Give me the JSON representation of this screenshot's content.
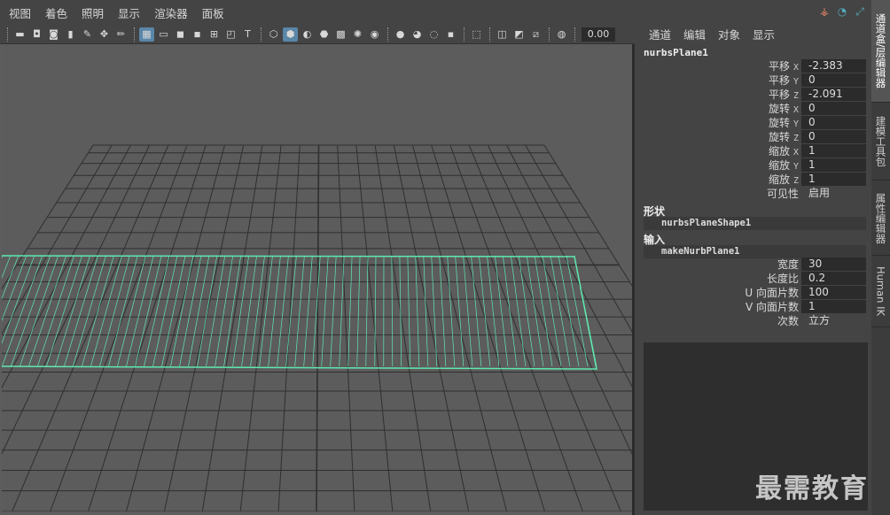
{
  "menubar": [
    "视图",
    "着色",
    "照明",
    "显示",
    "渲染器",
    "面板"
  ],
  "toolbar": {
    "groups": [
      [
        {
          "icon": "camera-icon",
          "glyph": "▬"
        },
        {
          "icon": "camera-attr-icon",
          "glyph": "◘"
        },
        {
          "icon": "camera-bookmark-icon",
          "glyph": "◙"
        },
        {
          "icon": "bookmark-icon",
          "glyph": "▮"
        },
        {
          "icon": "image-plane-icon",
          "glyph": "✎"
        },
        {
          "icon": "2d-pan-zoom-icon",
          "glyph": "✥"
        },
        {
          "icon": "grease-pencil-icon",
          "glyph": "✏"
        }
      ],
      [
        {
          "icon": "grid-icon",
          "glyph": "▦",
          "active": true
        },
        {
          "icon": "film-gate-icon",
          "glyph": "▭"
        },
        {
          "icon": "resolution-gate-icon",
          "glyph": "◼"
        },
        {
          "icon": "gate-mask-icon",
          "glyph": "◾"
        },
        {
          "icon": "field-chart-icon",
          "glyph": "⊞"
        },
        {
          "icon": "safe-action-icon",
          "glyph": "◰"
        },
        {
          "icon": "safe-title-icon",
          "glyph": "T"
        }
      ],
      [
        {
          "icon": "wireframe-icon",
          "glyph": "⬡"
        },
        {
          "icon": "smooth-shade-icon",
          "glyph": "⬢",
          "active": true
        },
        {
          "icon": "default-material-icon",
          "glyph": "◐"
        },
        {
          "icon": "wireframe-on-shaded-icon",
          "glyph": "⬣"
        },
        {
          "icon": "textured-icon",
          "glyph": "▩"
        },
        {
          "icon": "lights-icon",
          "glyph": "✺"
        },
        {
          "icon": "shadows-icon",
          "glyph": "◉"
        }
      ],
      [
        {
          "icon": "screen-space-ao-icon",
          "glyph": "●"
        },
        {
          "icon": "motion-blur-icon",
          "glyph": "◕"
        },
        {
          "icon": "anti-aliasing-icon",
          "glyph": "◌"
        },
        {
          "icon": "depth-of-field-icon",
          "glyph": "▪"
        }
      ],
      [
        {
          "icon": "isolate-select-icon",
          "glyph": "⬚"
        }
      ],
      [
        {
          "icon": "xray-icon",
          "glyph": "◫"
        },
        {
          "icon": "xray-joints-icon",
          "glyph": "◩"
        },
        {
          "icon": "xray-components-icon",
          "glyph": "⧄"
        }
      ],
      [
        {
          "icon": "exposure-icon",
          "glyph": "◍"
        }
      ]
    ],
    "time_value": "0.00"
  },
  "channel_box": {
    "menu": [
      "通道",
      "编辑",
      "对象",
      "显示"
    ],
    "object_name": "nurbsPlane1",
    "attributes": [
      {
        "label": "平移",
        "axis": "X",
        "value": "-2.383"
      },
      {
        "label": "平移",
        "axis": "Y",
        "value": "0"
      },
      {
        "label": "平移",
        "axis": "Z",
        "value": "-2.091"
      },
      {
        "label": "旋转",
        "axis": "X",
        "value": "0"
      },
      {
        "label": "旋转",
        "axis": "Y",
        "value": "0"
      },
      {
        "label": "旋转",
        "axis": "Z",
        "value": "0"
      },
      {
        "label": "缩放",
        "axis": "X",
        "value": "1"
      },
      {
        "label": "缩放",
        "axis": "Y",
        "value": "1"
      },
      {
        "label": "缩放",
        "axis": "Z",
        "value": "1"
      },
      {
        "label": "可见性",
        "axis": "",
        "value": "启用"
      }
    ],
    "shape_section": {
      "title": "形状",
      "node": "nurbsPlaneShape1"
    },
    "input_section": {
      "title": "输入",
      "node": "makeNurbPlane1",
      "attributes": [
        {
          "label": "宽度",
          "value": "30"
        },
        {
          "label": "长度比",
          "value": "0.2"
        },
        {
          "label": "U 向面片数",
          "value": "100"
        },
        {
          "label": "V 向面片数",
          "value": "1"
        },
        {
          "label": "次数",
          "value": "立方"
        }
      ]
    }
  },
  "side_tabs": [
    "通道盒/层编辑器",
    "建模工具包",
    "属性编辑器",
    "Human IK"
  ],
  "watermark": "最需教育",
  "colors": {
    "selection": "#5fe8b0",
    "grid": "#2f2f2f",
    "viewport_bg": "#5c5c5c"
  }
}
